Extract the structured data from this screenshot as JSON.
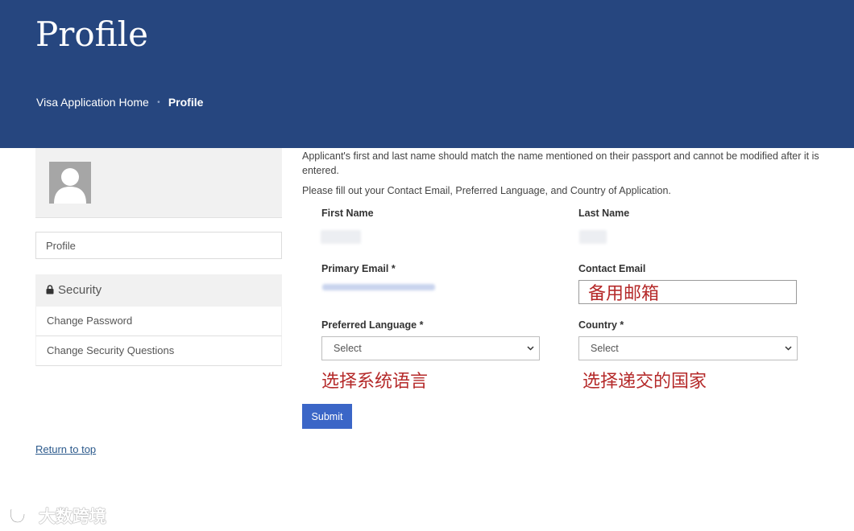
{
  "header": {
    "title": "Profile",
    "breadcrumb": {
      "home": "Visa Application Home",
      "current": "Profile"
    }
  },
  "sidebar": {
    "profile_link": "Profile",
    "security": {
      "heading": "Security",
      "items": [
        "Change Password",
        "Change Security Questions"
      ]
    }
  },
  "main": {
    "intro": "Applicant's first and last name should match the name mentioned on their passport and cannot be modified after it is entered.",
    "instructions": "Please fill out your Contact Email, Preferred Language, and Country of Application.",
    "fields": {
      "first_name_label": "First Name",
      "last_name_label": "Last Name",
      "primary_email_label": "Primary Email *",
      "contact_email_label": "Contact Email",
      "preferred_language_label": "Preferred Language *",
      "country_label": "Country *",
      "language_select_value": "Select",
      "country_select_value": "Select"
    },
    "submit_label": "Submit",
    "annotations": {
      "contact_email": "备用邮箱",
      "language": "选择系统语言",
      "country": "选择递交的国家"
    }
  },
  "footer": {
    "return_to_top": "Return to top"
  },
  "watermark": "大数跨境"
}
